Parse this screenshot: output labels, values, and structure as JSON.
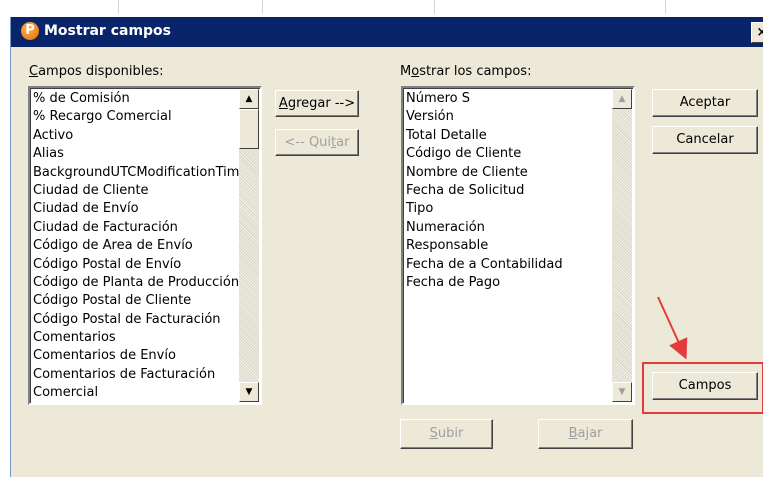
{
  "dialog": {
    "title": "Mostrar campos",
    "close_label": "×",
    "app_icon_letter": "P"
  },
  "available": {
    "label_accel": "C",
    "label_rest": "ampos disponibles:",
    "items": [
      "% de Comisión",
      "% Recargo Comercial",
      "Activo",
      "Alias",
      "BackgroundUTCModificationTime",
      "Ciudad de Cliente",
      "Ciudad de Envío",
      "Ciudad de Facturación",
      "Código  de Area de Envío",
      "Código  Postal de Envío",
      "Código de Planta de Producción",
      "Código Postal de Cliente",
      "Código Postal de Facturación",
      "Comentarios",
      "Comentarios de Envío",
      "Comentarios de Facturación",
      "Comercial"
    ]
  },
  "shown": {
    "label_pre": "M",
    "label_accel": "o",
    "label_rest": "strar los campos:",
    "items": [
      "Número S",
      "Versión",
      "Total Detalle",
      "Código de Cliente",
      "Nombre de Cliente",
      "Fecha de Solicitud",
      "Tipo",
      "Numeración",
      "Responsable",
      "Fecha de a Contabilidad",
      "Fecha de Pago"
    ]
  },
  "buttons": {
    "add_accel": "A",
    "add_rest": "gregar -->",
    "remove_pre": "<-- Qui",
    "remove_accel": "t",
    "remove_rest": "ar",
    "accept": "Aceptar",
    "cancel": "Cancelar",
    "fields": "Campos",
    "up_accel": "S",
    "up_rest": "ubir",
    "down_accel": "B",
    "down_rest": "ajar"
  },
  "icons": {
    "scroll_up": "▲",
    "scroll_down": "▼"
  },
  "colors": {
    "titlebar": "#0a246a",
    "dialog_face": "#ece9d8",
    "annotation_red": "#e33b3b"
  }
}
